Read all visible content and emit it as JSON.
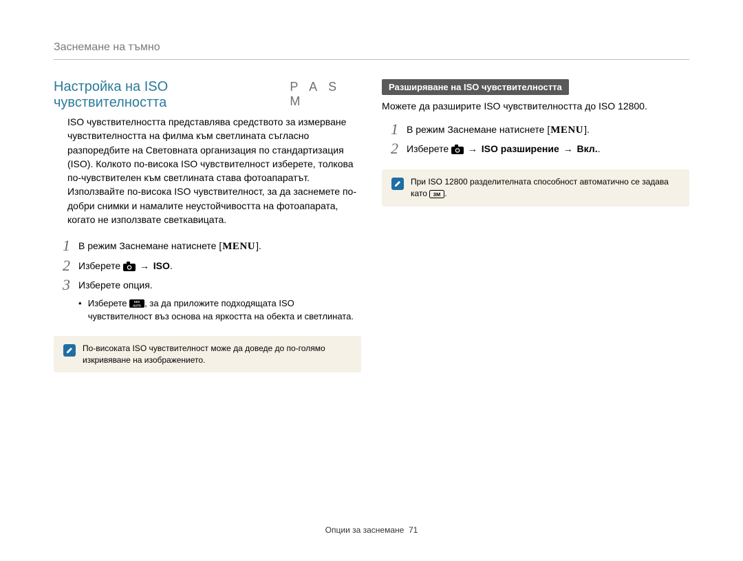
{
  "header": {
    "breadcrumb": "Заснемане на тъмно"
  },
  "colors": {
    "accent": "#2a7a9a",
    "badge_bg": "#595959",
    "note_bg": "#f5f1e6",
    "note_icon_bg": "#1f6ea4"
  },
  "icons": {
    "menu": "MENU",
    "camera": "camera-icon",
    "iso_auto": "iso-auto-icon",
    "resolution_3m": "3m-resolution-icon",
    "note": "pencil-note-icon"
  },
  "left": {
    "title": "Настройка на ISO чувствителността",
    "modes": "P  A  S  M",
    "body": "ISO чувствителността представлява средството за измерване чувствителността на филма към светлината съгласно разпоредбите на Световната организация по стандартизация (ISO). Колкото по-висока ISO чувствителност изберете, толкова по-чувствителен към светлината става фотоапаратът. Използвайте по-висока ISO чувствителност, за да заснемете по-добри снимки и намалите неустойчивостта на фотоапарата, когато не използвате светкавицата.",
    "steps": [
      {
        "num": "1",
        "text_pre": "В режим Заснемане натиснете [",
        "text_post": "]."
      },
      {
        "num": "2",
        "text_pre": "Изберете ",
        "text_mid": " → ",
        "text_bold": "ISO",
        "text_post": "."
      },
      {
        "num": "3",
        "text": "Изберете опция."
      }
    ],
    "bullet": {
      "pre": "Изберете ",
      "post": ", за да приложите подходящата ISO чувствителност въз основа на яркостта на обекта и светлината."
    },
    "note": "По-високата ISO чувствителност може да доведе до по-голямо изкривяване на изображението."
  },
  "right": {
    "badge": "Разширяване на ISO чувствителността",
    "intro": "Можете да разширите ISO чувствителността до ISO 12800.",
    "steps": [
      {
        "num": "1",
        "text_pre": "В режим Заснемане натиснете [",
        "text_post": "]."
      },
      {
        "num": "2",
        "text_pre": "Изберете ",
        "text_mid1": " → ",
        "text_bold1": "ISO разширение",
        "text_mid2": " → ",
        "text_bold2": "Вкл.",
        "text_post": "."
      }
    ],
    "note": {
      "pre": "При ISO 12800 разделителната способност автоматично се задава като ",
      "post": "."
    }
  },
  "footer": {
    "section": "Опции за заснемане",
    "page": "71"
  }
}
